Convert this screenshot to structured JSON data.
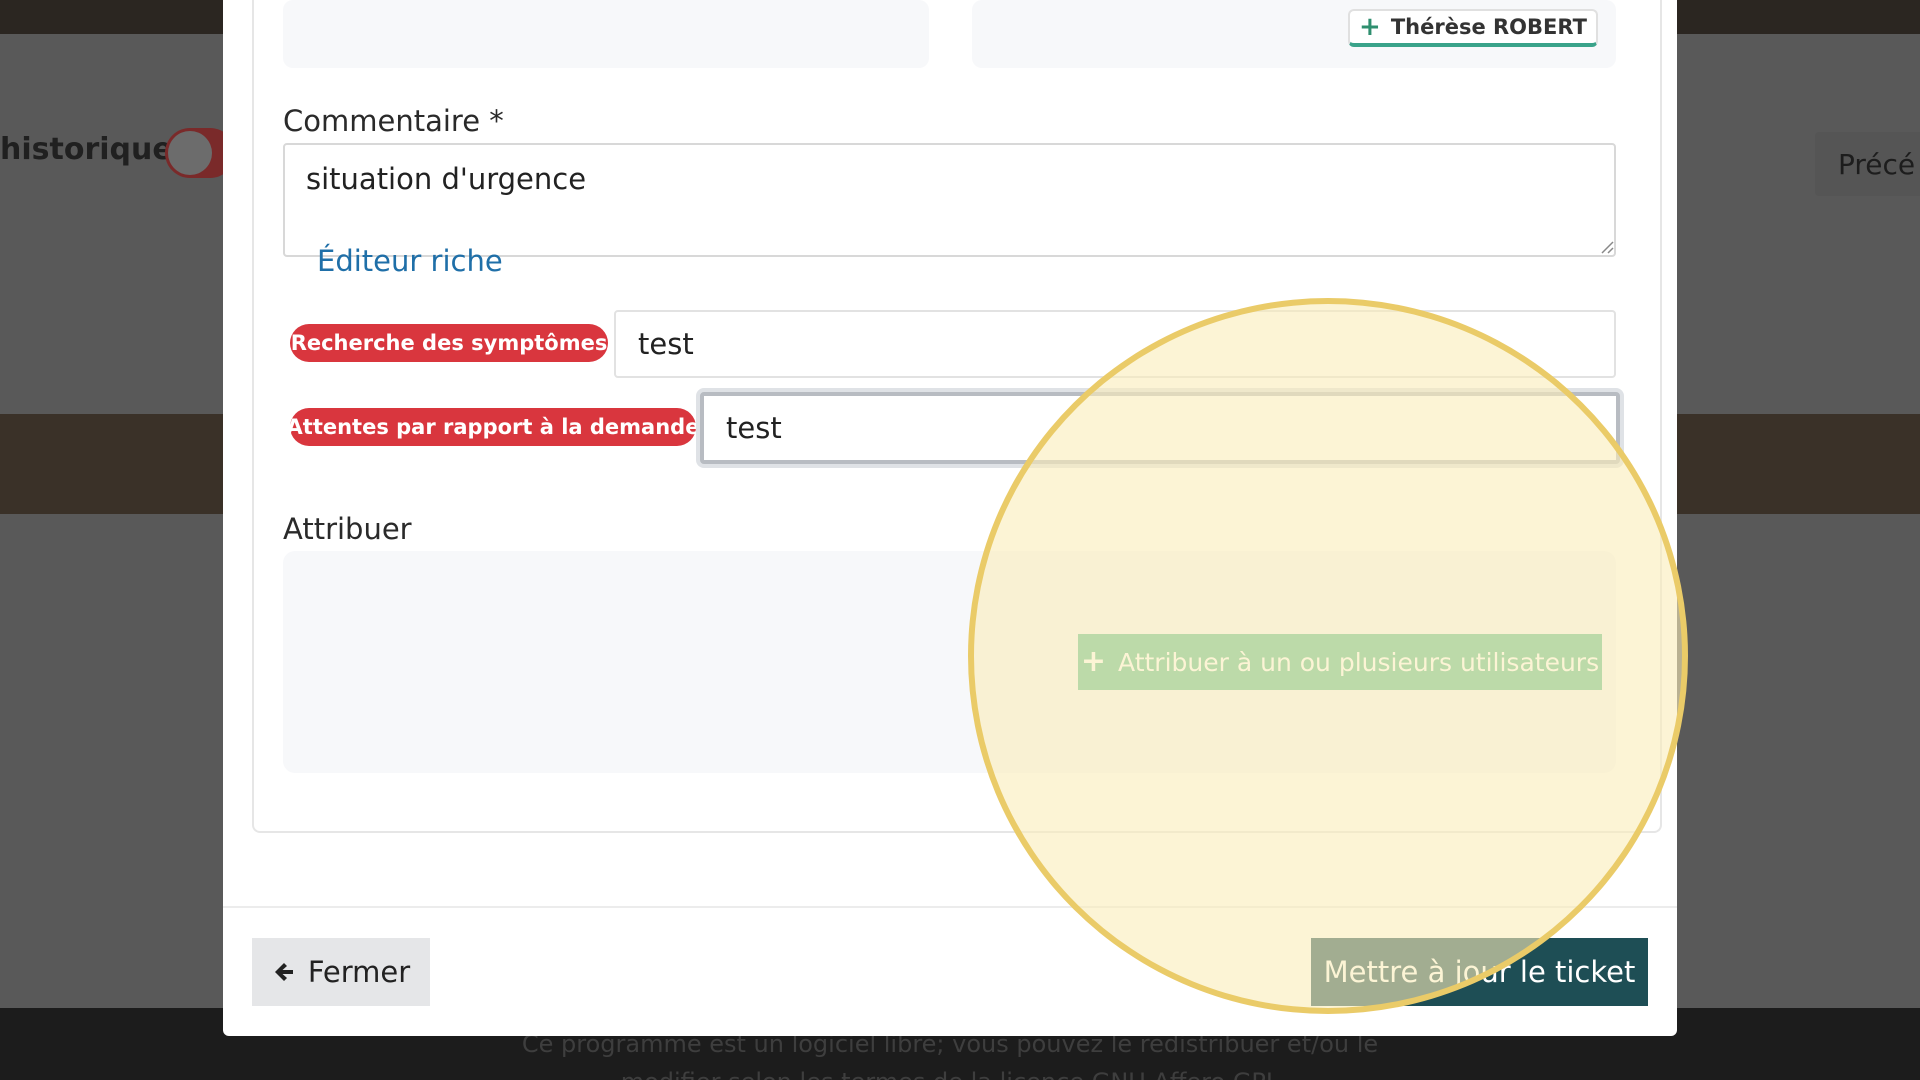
{
  "background": {
    "historique_label": "historique",
    "prec_label": "Précé",
    "footer_line1": "Ce programme est un logiciel libre; vous pouvez le redistribuer et/ou le",
    "footer_line2": "modifier selon les termes de la licence GNU Affero GPL"
  },
  "modal": {
    "assigned_user": {
      "name": "Thérèse ROBERT",
      "icon": "plus-icon"
    },
    "comment": {
      "label": "Commentaire *",
      "value": "situation d'urgence",
      "rich_editor_link": "Éditeur riche"
    },
    "fields": [
      {
        "badge": "Recherche des symptômes",
        "value": "test"
      },
      {
        "badge": "Attentes par rapport à la demande",
        "value": "test"
      }
    ],
    "assign": {
      "label": "Attribuer",
      "button_label": "Attribuer à un ou plusieurs utilisateurs",
      "icon": "plus-icon"
    },
    "footer": {
      "close_label": "Fermer",
      "close_icon": "arrow-left-icon",
      "submit_label": "Mettre à jour le ticket"
    }
  },
  "colors": {
    "badge_red": "#d9363e",
    "assign_green": "#5fbf91",
    "submit_teal": "#1e4e55",
    "link_blue": "#1f6fa8",
    "highlight": "#eacb68"
  }
}
